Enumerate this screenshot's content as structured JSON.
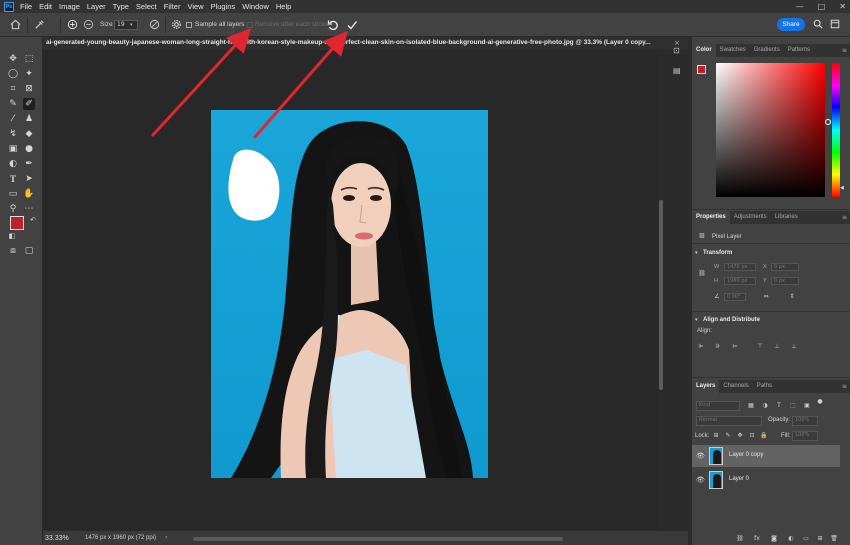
{
  "app": {
    "logo": "Ps",
    "menu": [
      "File",
      "Edit",
      "Image",
      "Layer",
      "Type",
      "Select",
      "Filter",
      "View",
      "Plugins",
      "Window",
      "Help"
    ],
    "window_controls": [
      "—",
      "□",
      "✕"
    ]
  },
  "options_bar": {
    "size_label": "Size",
    "size_value": "19",
    "sample_all_layers": "Sample all layers",
    "remove_after_stroke": "Remove after each stroke",
    "share_label": "Share",
    "icons": [
      "home-icon",
      "remove-tool-icon",
      "add-brush-icon",
      "subtract-brush-icon",
      "brush-options-icon",
      "pressure-icon",
      "settings-icon",
      "reset-icon",
      "apply-check-icon",
      "search-icon",
      "workspace-icon"
    ]
  },
  "document": {
    "tab_title": "ai-generated-young-beauty-japanese-woman-long-straight-hair-with-korean-style-makeup-and-perfect-clean-skin-on-isolated-blue-background-ai-generative-free-photo.jpg @ 33.3% (Layer 0 copy...",
    "close": "×"
  },
  "status": {
    "zoom": "33.33%",
    "doc_info": "1476 px x 1960 px (72 ppi)"
  },
  "colors": {
    "foreground": "#c0202d",
    "background": "#000000",
    "accent": "#1473e6",
    "annotation_arrow": "#e0262e"
  },
  "color_panel": {
    "tabs": [
      "Color",
      "Swatches",
      "Gradients",
      "Patterns"
    ]
  },
  "properties_panel": {
    "tabs": [
      "Properties",
      "Adjustments",
      "Libraries"
    ],
    "layer_type": "Pixel Layer",
    "transform_title": "Transform",
    "w_label": "W",
    "w_value": "1476 px",
    "h_label": "H",
    "h_value": "1960 px",
    "x_label": "X",
    "x_value": "0 px",
    "y_label": "Y",
    "y_value": "0 px",
    "angle_value": "0.00°",
    "align_title": "Align and Distribute",
    "align_label": "Align:"
  },
  "layers_panel": {
    "tabs": [
      "Layers",
      "Channels",
      "Paths"
    ],
    "search_placeholder": "Kind",
    "blend_mode": "Normal",
    "opacity_label": "Opacity:",
    "opacity_value": "100%",
    "lock_label": "Lock:",
    "fill_label": "Fill:",
    "fill_value": "100%",
    "layers": [
      {
        "name": "Layer 0 copy",
        "selected": true
      },
      {
        "name": "Layer 0",
        "selected": false
      }
    ]
  }
}
